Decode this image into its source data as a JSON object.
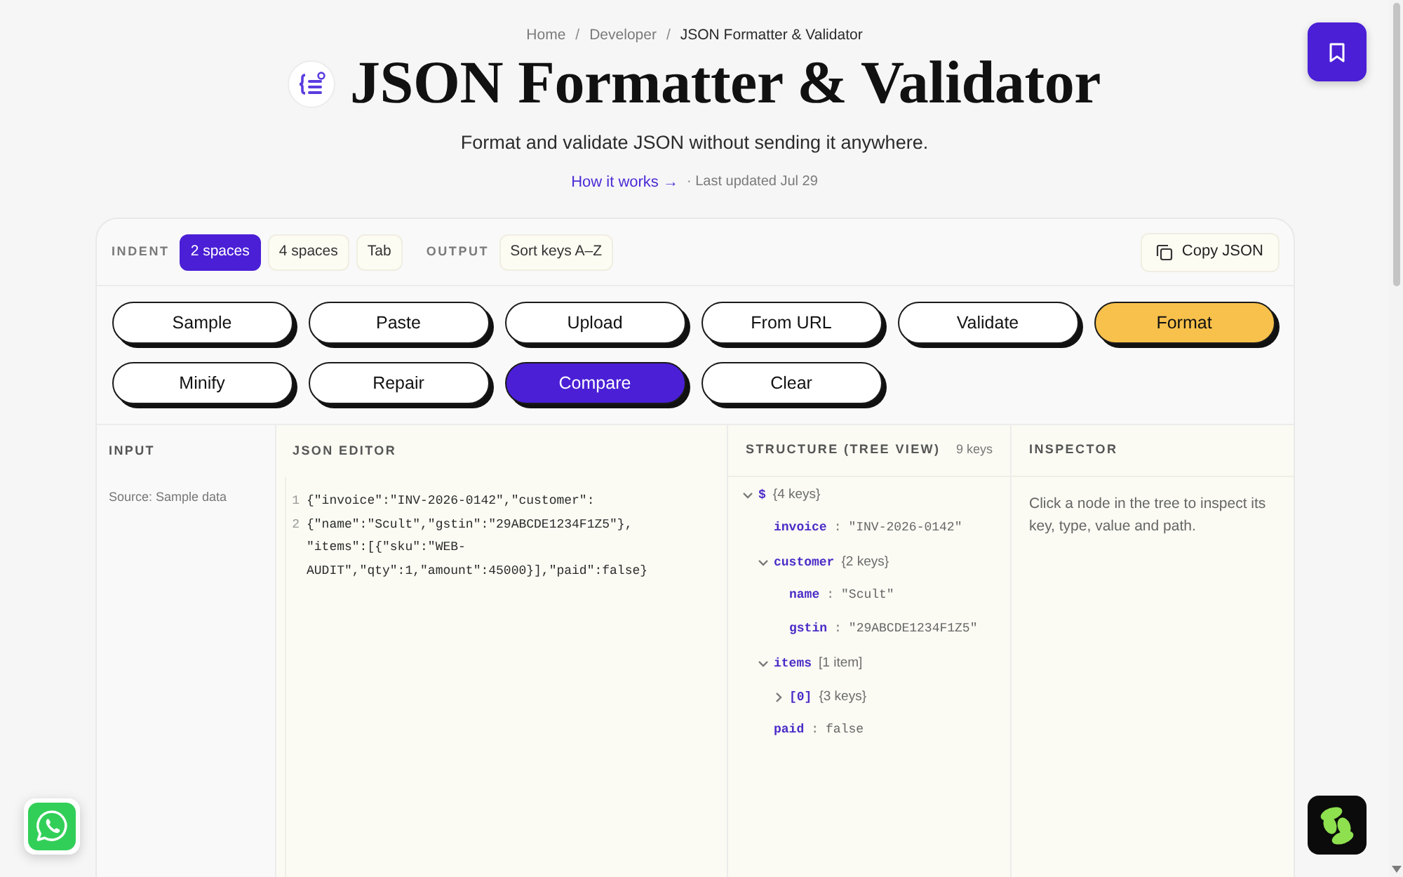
{
  "breadcrumb": {
    "separator": "/",
    "items": [
      {
        "label": "Home",
        "current": false
      },
      {
        "label": "Developer",
        "current": false
      },
      {
        "label": "JSON Formatter & Validator",
        "current": true
      }
    ]
  },
  "header": {
    "title": "JSON Formatter & Validator",
    "subtitle": "Format and validate JSON without sending it anywhere.",
    "link": "How it works →",
    "updated": "· Last updated Jul 29"
  },
  "toolbar": {
    "indent_label": "INDENT",
    "indent_options": [
      {
        "label": "2 spaces",
        "selected": true
      },
      {
        "label": "4 spaces",
        "selected": false
      },
      {
        "label": "Tab",
        "selected": false
      }
    ],
    "output_label": "OUTPUT",
    "output_options": [
      {
        "label": "Sort keys A–Z",
        "on": false
      }
    ],
    "copy_button": "Copy JSON"
  },
  "actions": [
    {
      "label": "Sample",
      "kind": "plain"
    },
    {
      "label": "Paste",
      "kind": "plain"
    },
    {
      "label": "Upload",
      "kind": "plain"
    },
    {
      "label": "From URL",
      "kind": "plain"
    },
    {
      "label": "Validate",
      "kind": "plain"
    },
    {
      "label": "Format",
      "kind": "primary"
    },
    {
      "label": "Minify",
      "kind": "plain"
    },
    {
      "label": "Repair",
      "kind": "plain"
    },
    {
      "label": "Compare",
      "kind": "active"
    },
    {
      "label": "Clear",
      "kind": "plain"
    }
  ],
  "input_panel": {
    "title": "INPUT",
    "source": "Source: Sample data"
  },
  "editor": {
    "title": "JSON EDITOR",
    "line_numbers": [
      "1",
      "2"
    ],
    "code_lines": [
      "{\"invoice\":\"INV-2026-0142\",\"customer\":",
      "{\"name\":\"Scult\",\"gstin\":\"29ABCDE1234F1Z5\"},",
      "\"items\":[{\"sku\":\"WEB-",
      "AUDIT\",\"qty\":1,\"amount\":45000}],\"paid\":false}"
    ]
  },
  "structure": {
    "title": "STRUCTURE (TREE VIEW)",
    "count": "9 keys",
    "separator": ":",
    "tree": [
      {
        "key": "$",
        "summary": "{4 keys}",
        "expanded": true,
        "children": [
          {
            "key": "invoice",
            "value": "\"INV-2026-0142\""
          },
          {
            "key": "customer",
            "summary": "{2 keys}",
            "expanded": true,
            "children": [
              {
                "key": "name",
                "value": "\"Scult\""
              },
              {
                "key": "gstin",
                "value": "\"29ABCDE1234F1Z5\""
              }
            ]
          },
          {
            "key": "items",
            "summary": "[1 item]",
            "expanded": true,
            "children": [
              {
                "key": "[0]",
                "summary": "{3 keys}",
                "expanded": false
              }
            ]
          },
          {
            "key": "paid",
            "value": "false"
          }
        ]
      }
    ]
  },
  "inspector": {
    "title": "INSPECTOR",
    "hint": "Click a node in the tree to inspect its key, type, value and path."
  }
}
